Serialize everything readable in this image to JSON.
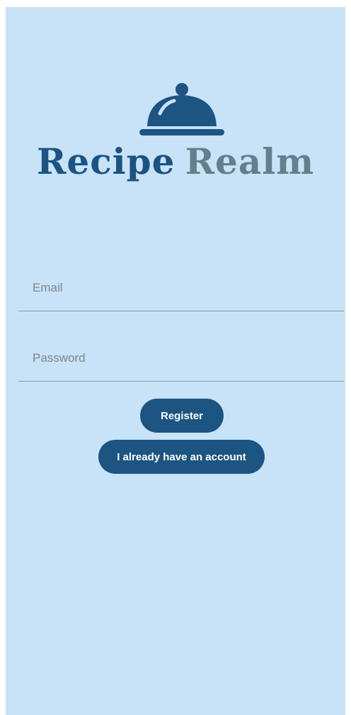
{
  "app": {
    "brand_word_1": "Recipe",
    "brand_word_2": "Realm",
    "logo_icon": "cloche-icon"
  },
  "form": {
    "email_placeholder": "Email",
    "email_value": "",
    "password_placeholder": "Password",
    "password_value": ""
  },
  "buttons": {
    "register_label": "Register",
    "have_account_label": "I already have an account"
  },
  "colors": {
    "background": "#c8e2f7",
    "primary": "#1c5482",
    "brand_secondary": "#647f8a",
    "underline": "#8a99a3"
  }
}
